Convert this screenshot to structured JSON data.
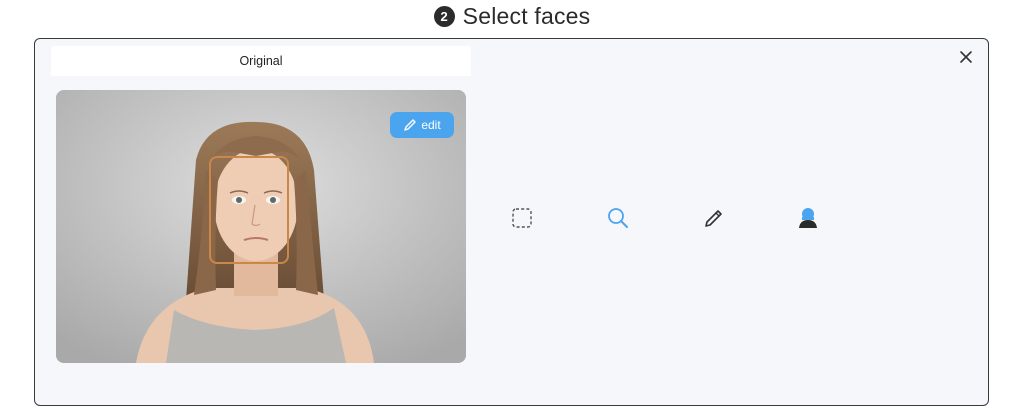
{
  "header": {
    "step_number": "2",
    "title": "Select faces"
  },
  "modal": {
    "tab_label": "Original",
    "edit_label": "edit",
    "tools": [
      {
        "name": "box-select-icon",
        "color": "#555555"
      },
      {
        "name": "search-icon",
        "color": "#4aa4ee"
      },
      {
        "name": "pencil-icon",
        "color": "#333333"
      },
      {
        "name": "person-icon",
        "color": "#4aa4ee"
      }
    ]
  },
  "colors": {
    "accent": "#4aa4ee",
    "face_box": "#c9884a",
    "modal_bg": "#f6f7fa"
  }
}
